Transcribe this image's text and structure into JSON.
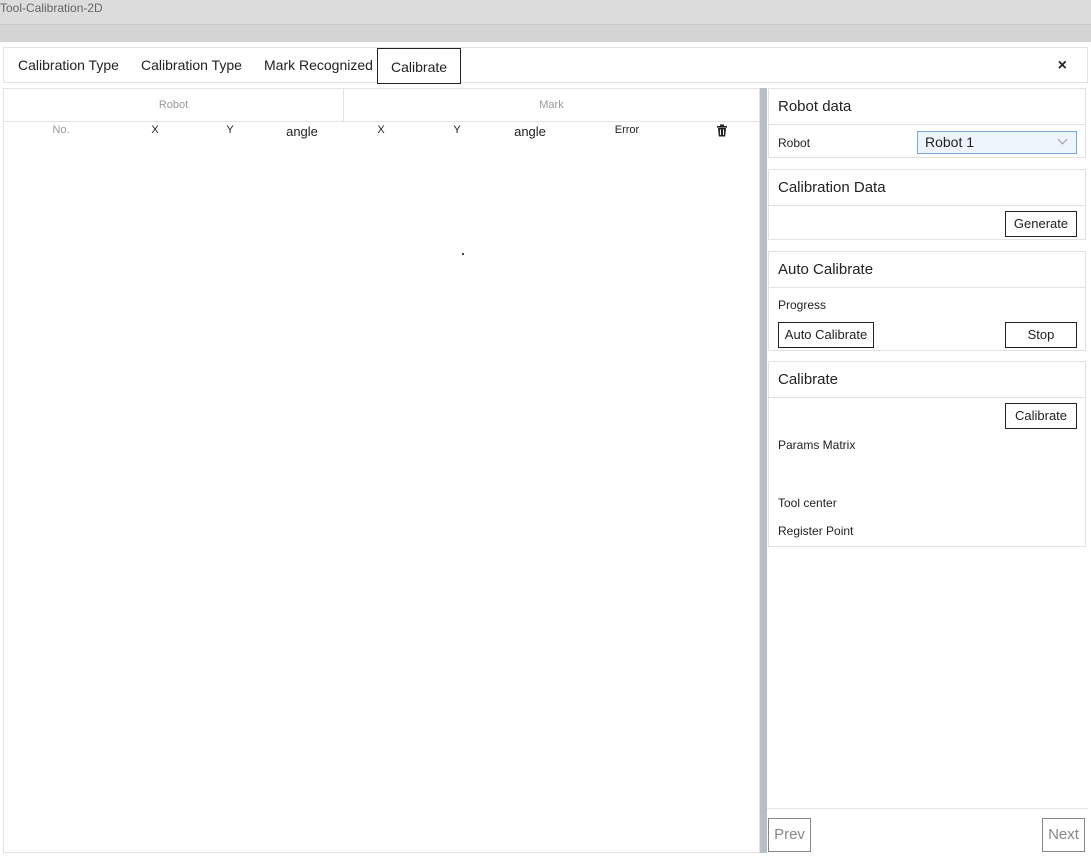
{
  "window": {
    "title": "Tool-Calibration-2D"
  },
  "tabs": [
    {
      "label": "Calibration Type"
    },
    {
      "label": "Calibration Type"
    },
    {
      "label": "Mark Recognized"
    },
    {
      "label": "Calibrate"
    }
  ],
  "close_icon": "×",
  "table": {
    "groups": {
      "robot": "Robot",
      "mark": "Mark"
    },
    "columns": {
      "no": "No.",
      "robot_x": "X",
      "robot_y": "Y",
      "robot_angle": "angle",
      "mark_x": "X",
      "mark_y": "Y",
      "mark_angle": "angle",
      "error": "Error"
    },
    "rows": [],
    "delete_icon": "trash-icon"
  },
  "robot_data": {
    "title": "Robot data",
    "robot_label": "Robot",
    "robot_value": "Robot 1"
  },
  "calibration_data": {
    "title": "Calibration Data",
    "generate_label": "Generate"
  },
  "auto_calibrate": {
    "title": "Auto Calibrate",
    "progress_label": "Progress",
    "auto_button": "Auto Calibrate",
    "stop_button": "Stop"
  },
  "calibrate": {
    "title": "Calibrate",
    "calibrate_button": "Calibrate",
    "params_label": "Params Matrix",
    "tool_center_label": "Tool center",
    "register_label": "Register Point"
  },
  "nav": {
    "prev": "Prev",
    "next": "Next"
  }
}
